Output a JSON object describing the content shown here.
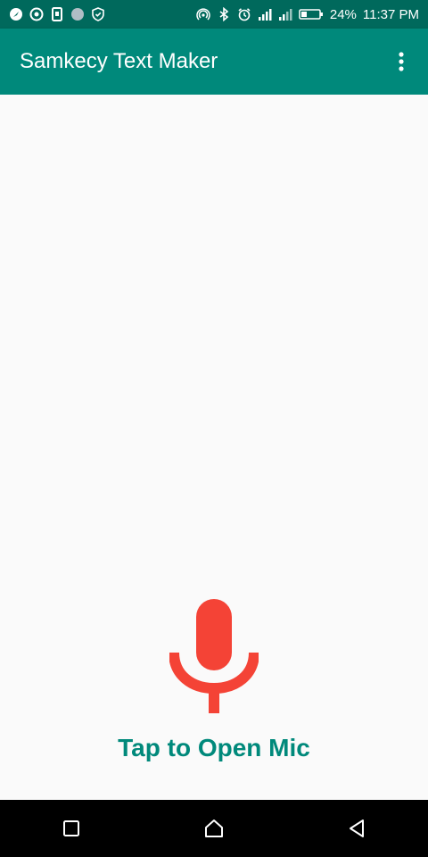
{
  "status_bar": {
    "battery_percent": "24%",
    "time": "11:37 PM",
    "left_icons": [
      "navigation-icon",
      "target-icon",
      "phone-storage-icon",
      "circle-icon",
      "shield-icon"
    ],
    "right_icons": [
      "hotspot-icon",
      "bluetooth-icon",
      "alarm-icon",
      "signal-icon",
      "signal-h-icon",
      "battery-icon"
    ]
  },
  "app_bar": {
    "title": "Samkecy Text Maker",
    "menu_icon": "more-vert-icon"
  },
  "main": {
    "mic_icon": "microphone-icon",
    "mic_color": "#f44336",
    "label": "Tap to Open Mic"
  },
  "nav_bar": {
    "buttons": [
      "recent-apps-icon",
      "home-icon",
      "back-icon"
    ]
  },
  "colors": {
    "status_bar": "#00695c",
    "app_bar": "#00897b",
    "accent_text": "#00897b",
    "background": "#fafafa"
  }
}
